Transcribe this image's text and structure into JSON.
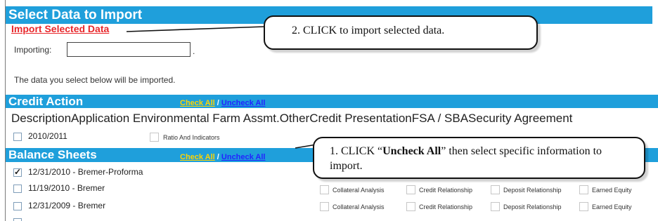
{
  "page": {
    "title": "Select Data to Import",
    "import_link": "Import Selected Data",
    "importing_label": "Importing:",
    "importing_value": "",
    "importing_suffix": ".",
    "info_text": "The data you select below will be imported."
  },
  "credit_action": {
    "header": "Credit Action",
    "check_all": "Check All",
    "separator": " / ",
    "uncheck_all": "Uncheck All",
    "columns_line": "DescriptionApplication Environmental Farm Assmt.OtherCredit PresentationFSA / SBASecurity Agreement",
    "rows": [
      {
        "label": "2010/2011",
        "checked": false,
        "options": [
          {
            "label": "Ratio And Indicators",
            "checked": false
          }
        ]
      }
    ]
  },
  "balance_sheets": {
    "header": "Balance Sheets",
    "check_all": "Check All",
    "separator": " / ",
    "uncheck_all": "Uncheck All",
    "rows": [
      {
        "label": "12/31/2010 - Bremer-Proforma",
        "checked": true
      },
      {
        "label": "11/19/2010 - Bremer",
        "checked": false,
        "options": [
          "Collateral Analysis",
          "Credit Relationship",
          "Deposit Relationship",
          "Earned Equity"
        ]
      },
      {
        "label": "12/31/2009 - Bremer",
        "checked": false,
        "options": [
          "Collateral Analysis",
          "Credit Relationship",
          "Deposit Relationship",
          "Earned Equity"
        ]
      }
    ]
  },
  "callouts": {
    "first": {
      "text_before": "1. CLICK “",
      "bold": "Uncheck All",
      "text_after": "” then select specific information to import."
    },
    "second": {
      "text": "2. CLICK to import selected data."
    }
  }
}
